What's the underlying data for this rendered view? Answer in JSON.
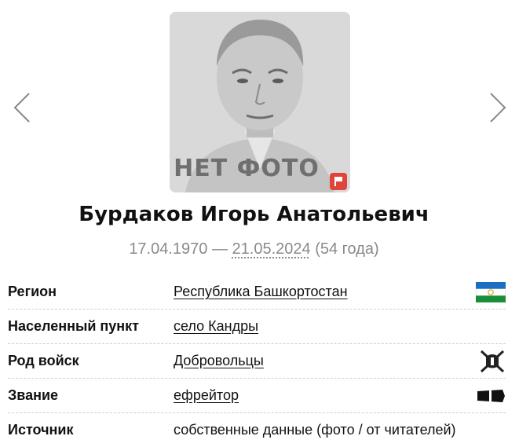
{
  "profile": {
    "photo_placeholder": "НЕТ ФОТО",
    "name": "Бурдаков Игорь Анатольевич",
    "birth_date": "17.04.1970",
    "date_separator": " — ",
    "death_date": "21.05.2024",
    "age": " (54 года)"
  },
  "details": {
    "region": {
      "label": "Регион",
      "value": "Республика Башкортостан"
    },
    "settlement": {
      "label": "Населенный пункт",
      "value": "село Кандры"
    },
    "branch": {
      "label": "Род войск",
      "value": "Добровольцы"
    },
    "rank": {
      "label": "Звание",
      "value": "ефрейтор"
    },
    "source": {
      "label": "Источник",
      "value": "собственные данные (фото / от читателей)"
    }
  },
  "icons": {
    "prev": "chevron-left-icon",
    "next": "chevron-right-icon",
    "report": "flag-icon",
    "region_flag": "bashkortostan-flag-icon",
    "branch": "crossed-swords-helmet-icon",
    "rank": "rank-epaulette-icon"
  },
  "colors": {
    "text": "#111111",
    "muted": "#8a8a8a",
    "report_button": "#e0453b",
    "flag_blue": "#1a6fc4",
    "flag_white": "#ffffff",
    "flag_green": "#1b8e3a"
  }
}
